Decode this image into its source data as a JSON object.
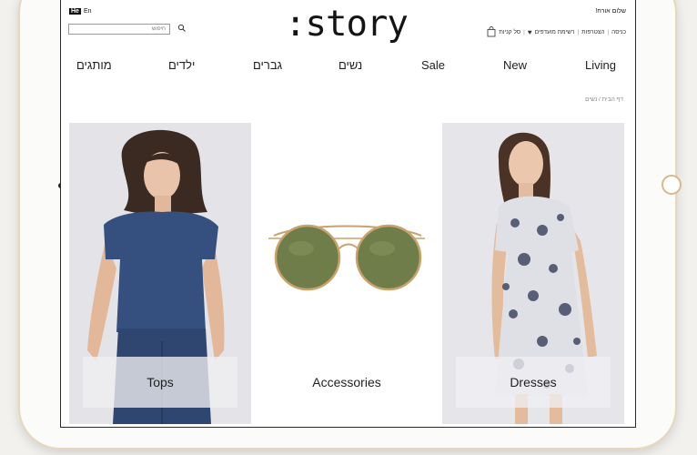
{
  "header": {
    "lang_he": "He",
    "lang_en": "En",
    "search_placeholder": "חיפוש",
    "logo": ":story",
    "greeting": "שלום אורח!",
    "links": [
      "כניסה",
      "הצטרפות",
      "רשימת מועדפים",
      "סל קניות"
    ]
  },
  "nav": [
    "מותגים",
    "ילדים",
    "גברים",
    "נשים",
    "Sale",
    "New",
    "Living"
  ],
  "breadcrumb": "דף הבית / נשים",
  "tiles": [
    {
      "label": "Tops"
    },
    {
      "label": "Accessories"
    },
    {
      "label": "Dresses"
    }
  ],
  "colors": {
    "frame_gold": "#d7b98c",
    "text": "#222222",
    "tile_bg": "#ecebee"
  }
}
